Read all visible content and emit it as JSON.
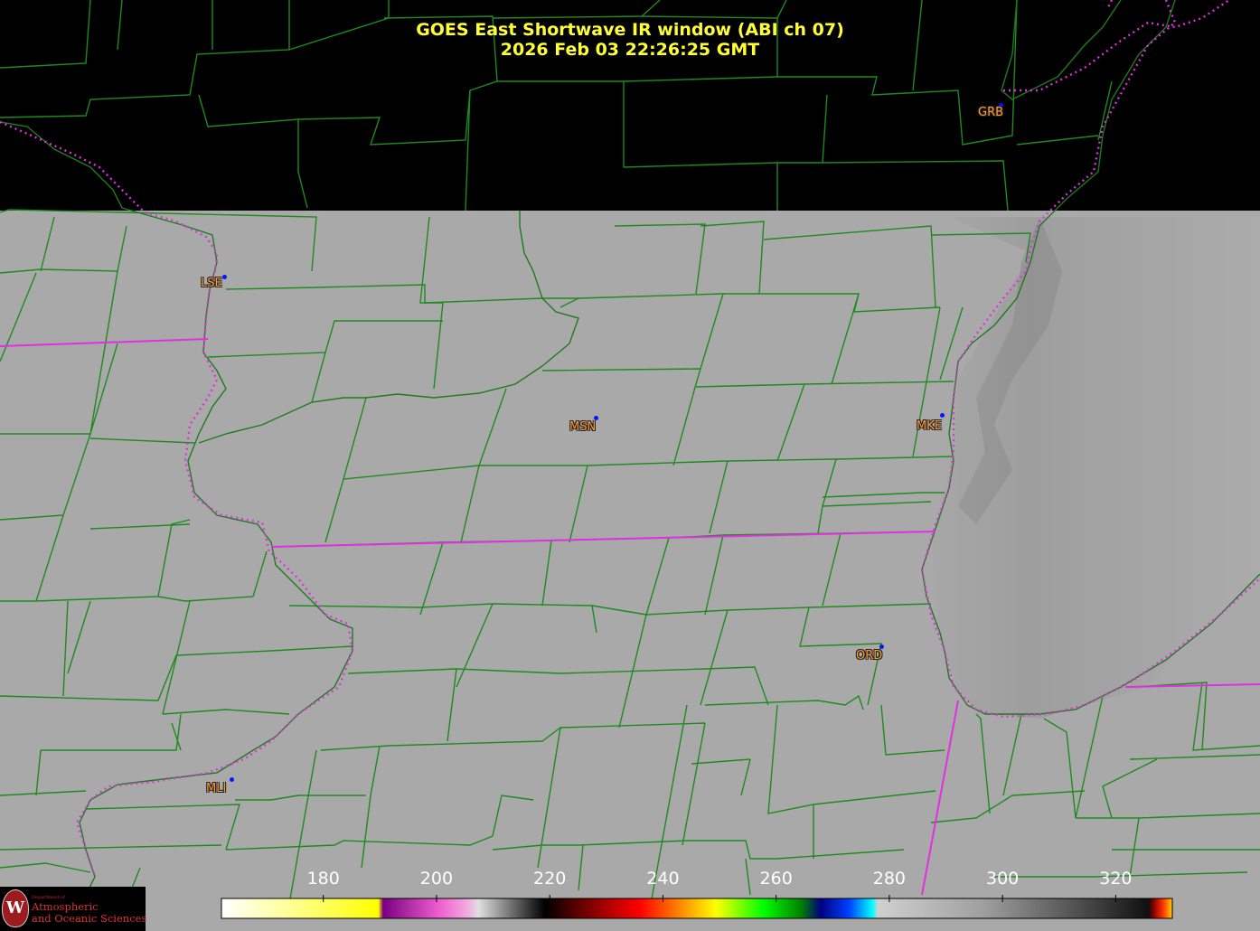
{
  "header": {
    "title_line1": "GOES East Shortwave IR window (ABI ch 07)",
    "title_line2": "2026 Feb 03  22:26:25 GMT"
  },
  "cities": [
    {
      "code": "GRB"
    },
    {
      "code": "LSE"
    },
    {
      "code": "MSN"
    },
    {
      "code": "MKE"
    },
    {
      "code": "ORD"
    },
    {
      "code": "MLI"
    }
  ],
  "colorbar": {
    "ticks": [
      "180",
      "200",
      "220",
      "240",
      "260",
      "280",
      "300",
      "320"
    ],
    "tick_values": [
      180,
      200,
      220,
      240,
      260,
      280,
      300,
      320
    ],
    "range": [
      162,
      330
    ]
  },
  "logo": {
    "dept": "Department of",
    "line1": "Atmospheric",
    "line2": "and Oceanic Sciences"
  },
  "colors": {
    "county_lines": "#1f8a1f",
    "state_lines": "#e030e0",
    "title_text": "#ffff33",
    "city_label": "#ff9933",
    "city_dot": "#0018ff",
    "no_data": "#000000",
    "cloud_gray": "#a8a8a8"
  }
}
